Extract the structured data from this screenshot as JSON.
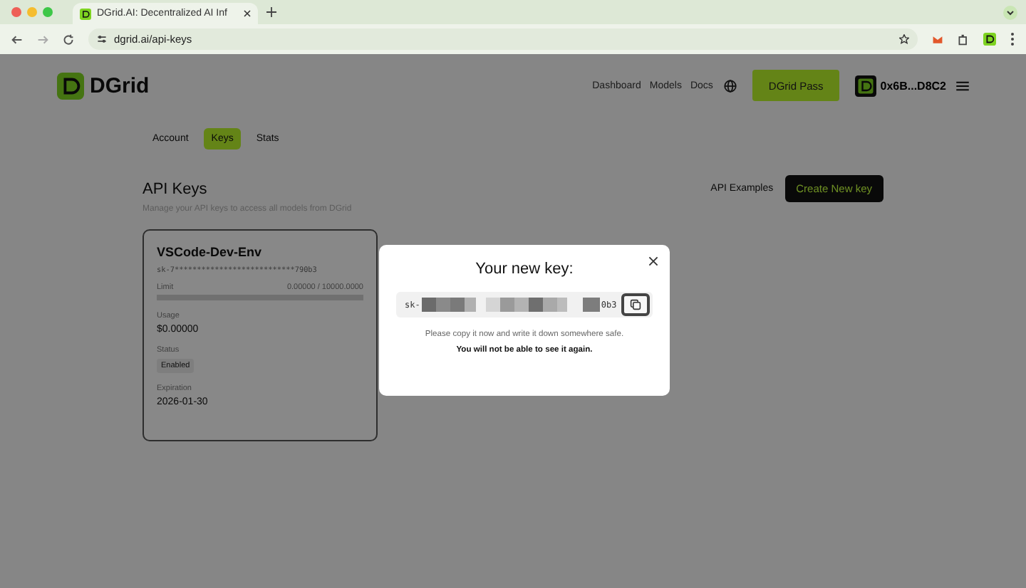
{
  "browser": {
    "tab_title": "DGrid.AI: Decentralized AI Inf",
    "url": "dgrid.ai/api-keys"
  },
  "header": {
    "logo": "DGrid",
    "nav": [
      "Dashboard",
      "Models",
      "Docs"
    ],
    "pass_button": "DGrid Pass",
    "wallet": "0x6B...D8C2"
  },
  "tabs": [
    {
      "label": "Account",
      "selected": false
    },
    {
      "label": "Keys",
      "selected": true
    },
    {
      "label": "Stats",
      "selected": false
    }
  ],
  "page": {
    "title": "API Keys",
    "subtitle": "Manage your API keys to access all models from DGrid",
    "examples_link": "API Examples",
    "create_button": "Create New key"
  },
  "keys": [
    {
      "name": "VSCode-Dev-Env",
      "key": "sk-7***************************790b3",
      "limit_label": "Limit",
      "limit_value": "0.00000 / 10000.0000",
      "level": 0,
      "usage_label": "Usage",
      "usage": "$0.00000",
      "status_label": "Status",
      "status": "Enabled",
      "expiration_label": "Expiration",
      "expiration": "2026-01-30"
    }
  ],
  "modal": {
    "title": "Your new key:",
    "key_prefix": "sk-",
    "key_suffix": "0b3",
    "note": "Please copy it now and write it down somewhere safe.",
    "warning": "You will not be able to see it again."
  }
}
